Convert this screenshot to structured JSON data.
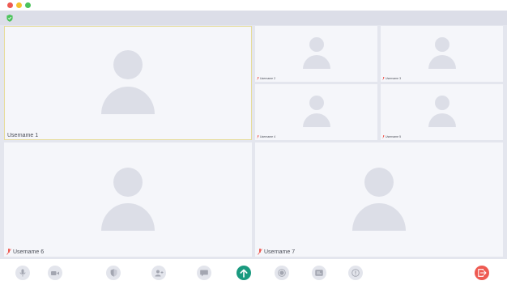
{
  "window": {
    "titlebar_buttons": [
      "close",
      "minimize",
      "maximize"
    ],
    "security_icon": "shield-check-icon",
    "accent_color": "#1a9a7f",
    "leave_color": "#ee5a52"
  },
  "participants": [
    {
      "name": "Username 1",
      "mic": "on",
      "active_speaker": true
    },
    {
      "name": "Username 2",
      "mic": "muted"
    },
    {
      "name": "Username 3",
      "mic": "muted"
    },
    {
      "name": "Username 4",
      "mic": "muted"
    },
    {
      "name": "Username 5",
      "mic": "muted"
    },
    {
      "name": "Username 6",
      "mic": "muted"
    },
    {
      "name": "Username 7",
      "mic": "muted"
    }
  ],
  "controls": [
    {
      "name": "microphone",
      "icon": "microphone-icon"
    },
    {
      "name": "camera",
      "icon": "video-camera-icon"
    },
    {
      "name": "security",
      "icon": "shield-icon"
    },
    {
      "name": "participants",
      "icon": "add-user-icon"
    },
    {
      "name": "chat",
      "icon": "chat-bubble-icon"
    },
    {
      "name": "share-screen",
      "icon": "arrow-up-icon"
    },
    {
      "name": "record",
      "icon": "record-icon"
    },
    {
      "name": "captions",
      "icon": "captions-icon"
    },
    {
      "name": "more",
      "icon": "more-icon"
    },
    {
      "name": "leave",
      "icon": "exit-icon"
    }
  ]
}
